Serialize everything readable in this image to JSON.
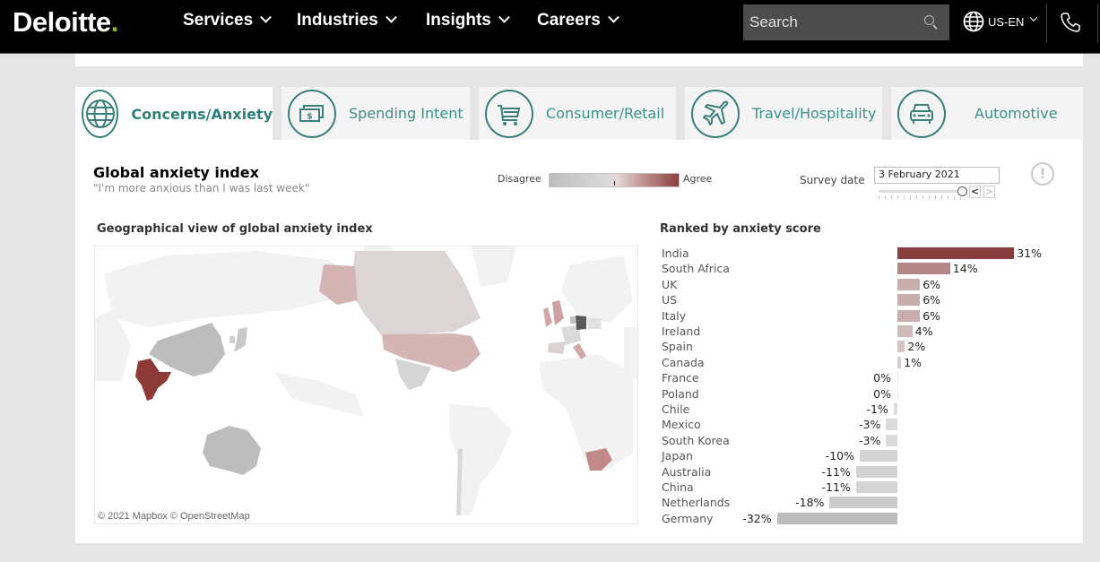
{
  "nav": {
    "logo": "Deloitte",
    "logo_dot": ".",
    "items": [
      {
        "label": "Services"
      },
      {
        "label": "Industries"
      },
      {
        "label": "Insights"
      },
      {
        "label": "Careers"
      }
    ],
    "search_placeholder": "Search",
    "locale": "US-EN",
    "icons": {
      "search": "search-icon",
      "globe": "globe-icon",
      "phone": "phone-icon"
    }
  },
  "tabs": [
    {
      "label": "Concerns/Anxiety",
      "icon": "globe-icon",
      "active": true
    },
    {
      "label": "Spending Intent",
      "icon": "money-icon",
      "active": false
    },
    {
      "label": "Consumer/Retail",
      "icon": "shopping-cart-icon",
      "active": false
    },
    {
      "label": "Travel/Hospitality",
      "icon": "airplane-icon",
      "active": false
    },
    {
      "label": "Automotive",
      "icon": "car-icon",
      "active": false
    }
  ],
  "dashboard": {
    "title": "Global anxiety index",
    "subtitle": "\"I'm more anxious than I was last week\"",
    "legend": {
      "low_label": "Disagree",
      "high_label": "Agree",
      "low_color": "#bdbdbd",
      "high_color": "#8b3e3e"
    },
    "survey_date_label": "Survey date",
    "survey_date_value": "3 February 2021",
    "prev_label": "<",
    "next_label": ">",
    "info_label": "!",
    "map_title": "Geographical view of global anxiety index",
    "map_attribution": "© 2021 Mapbox  © OpenStreetMap",
    "ranking_title": "Ranked by anxiety score"
  },
  "colors": {
    "accent_teal": "#3b8f89",
    "brand_green": "#86bc25",
    "positive_max": "#8b3e3e",
    "neutral": "#d0d0d0",
    "negative_max": "#bdbdbd"
  },
  "chart_data": {
    "type": "bar",
    "orientation": "horizontal",
    "title": "Ranked by anxiety score",
    "unit": "%",
    "categories": [
      "India",
      "South Africa",
      "UK",
      "US",
      "Italy",
      "Ireland",
      "Spain",
      "Canada",
      "France",
      "Poland",
      "Chile",
      "Mexico",
      "South Korea",
      "Japan",
      "Australia",
      "China",
      "Netherlands",
      "Germany"
    ],
    "values": [
      31,
      14,
      6,
      6,
      6,
      4,
      2,
      1,
      0,
      0,
      -1,
      -3,
      -3,
      -10,
      -11,
      -11,
      -18,
      -32
    ],
    "labels": [
      "31%",
      "14%",
      "6%",
      "6%",
      "6%",
      "4%",
      "2%",
      "1%",
      "0%",
      "0%",
      "-1%",
      "-3%",
      "-3%",
      "-10%",
      "-11%",
      "-11%",
      "-18%",
      "-32%"
    ],
    "xlim": [
      -32,
      31
    ],
    "grid": false
  }
}
